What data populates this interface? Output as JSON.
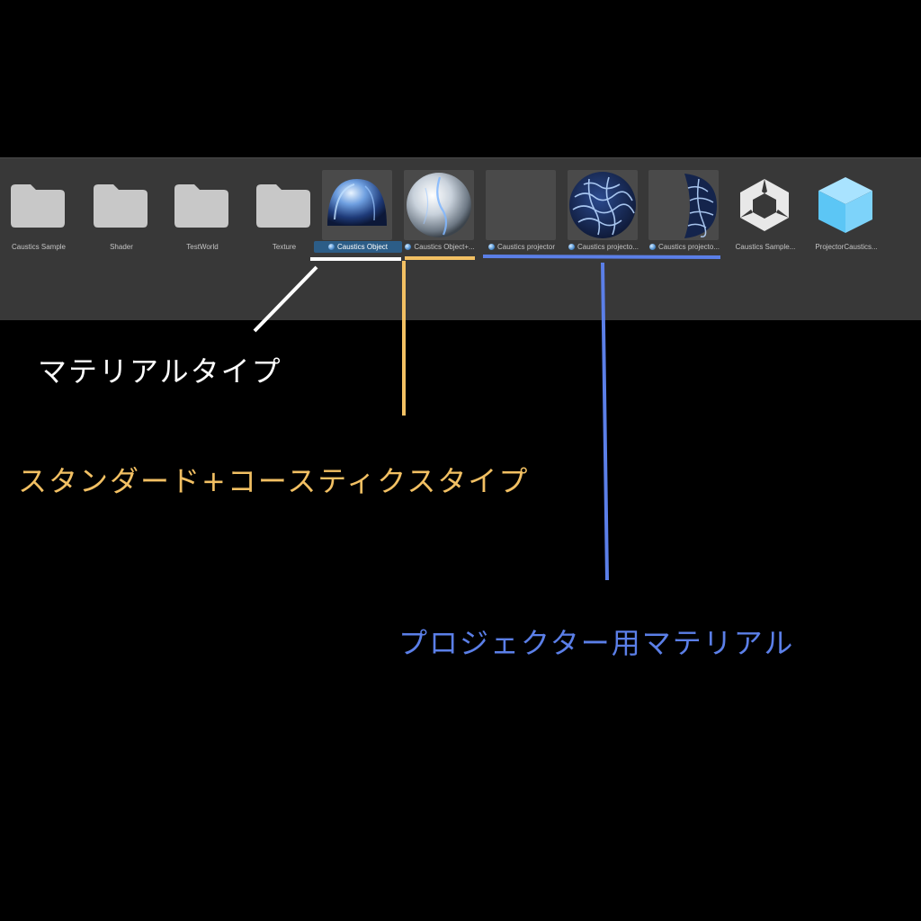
{
  "assets": [
    {
      "label": "Caustics Sample",
      "kind": "folder"
    },
    {
      "label": "Shader",
      "kind": "folder"
    },
    {
      "label": "TestWorld",
      "kind": "folder"
    },
    {
      "label": "Texture",
      "kind": "folder"
    },
    {
      "label": "Caustics Object",
      "kind": "material",
      "selected": true
    },
    {
      "label": "Caustics Object+...",
      "kind": "material"
    },
    {
      "label": "Caustics projector",
      "kind": "material"
    },
    {
      "label": "Caustics projecto...",
      "kind": "material"
    },
    {
      "label": "Caustics projecto...",
      "kind": "material"
    },
    {
      "label": "Caustics Sample...",
      "kind": "unity-scene"
    },
    {
      "label": "ProjectorCaustics...",
      "kind": "prefab"
    }
  ],
  "annotations": {
    "material_type": "マテリアルタイプ",
    "standard_caustics_type": "スタンダード+コースティクスタイプ",
    "projector_material": "プロジェクター用マテリアル"
  },
  "colors": {
    "panel": "#383838",
    "selection": "#2c5d87",
    "annotation_white": "#ffffff",
    "annotation_yellow": "#f2c063",
    "annotation_blue": "#5b7fe8"
  }
}
